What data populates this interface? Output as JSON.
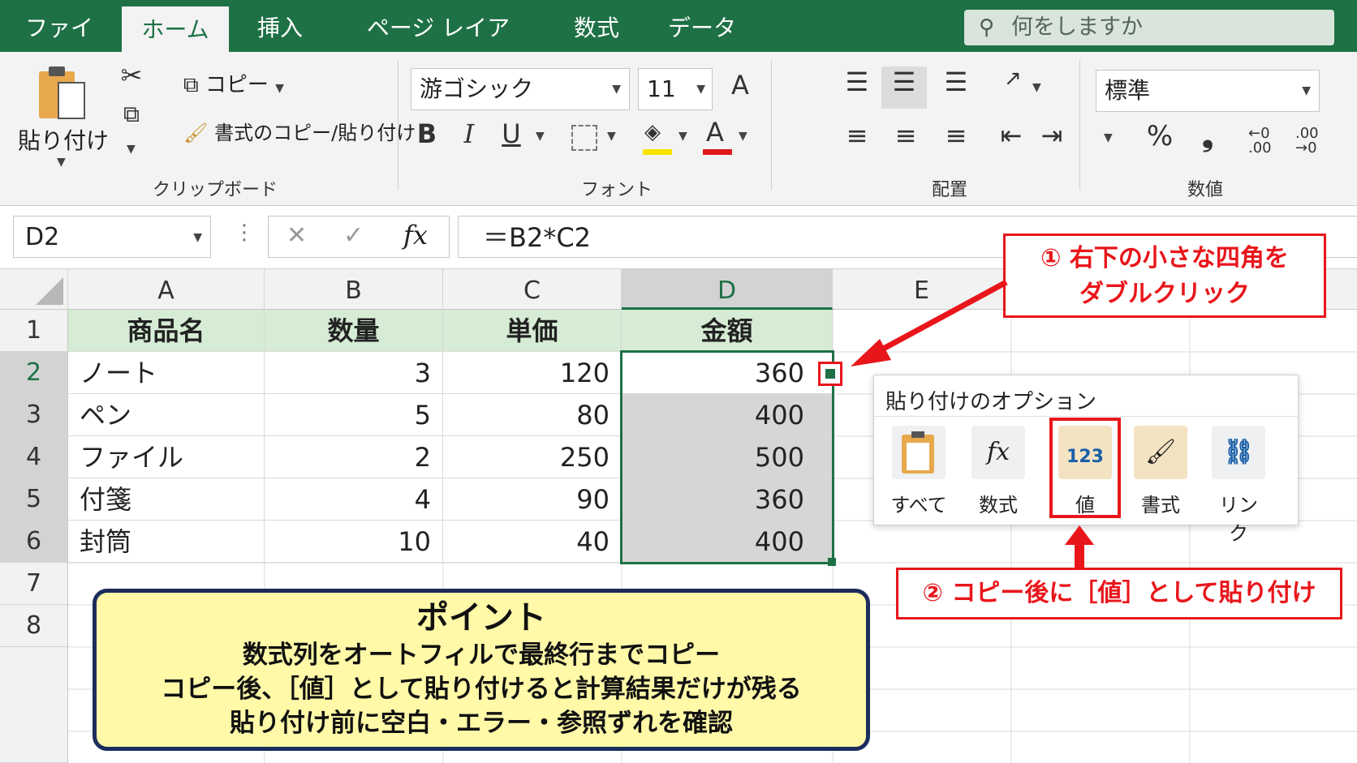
{
  "tabs": [
    "ファイル",
    "ホーム",
    "挿入",
    "ページ レイアウト",
    "数式",
    "データ"
  ],
  "search": {
    "placeholder": "何をしますか"
  },
  "ribbon": {
    "clipboard": {
      "paste_label": "貼り付け",
      "copy_label": "コピー",
      "format_painter_label": "書式のコピー/貼り付け",
      "group_label": "クリップボード"
    },
    "font": {
      "name": "游ゴシック",
      "size": "11",
      "group_label": "フォント",
      "bold": "B",
      "italic": "I",
      "underline": "U",
      "font_color_glyph": "A",
      "grow_glyph": "A"
    },
    "alignment": {
      "group_label": "配置"
    },
    "number": {
      "format": "標準",
      "group_label": "数値",
      "percent": "%",
      "comma": "❟",
      "inc_decimal": ".00",
      "dec_decimal": ".00"
    }
  },
  "formula_bar": {
    "name_box": "D2",
    "formula": "＝B2*C2",
    "fx": "fx"
  },
  "columns": [
    "A",
    "B",
    "C",
    "D",
    "E"
  ],
  "rows": [
    "1",
    "2",
    "3",
    "4",
    "5",
    "6",
    "7",
    "8"
  ],
  "table": {
    "headers": [
      "商品名",
      "数量",
      "単価",
      "金額"
    ],
    "data": [
      [
        "ノート",
        "3",
        "120",
        "360"
      ],
      [
        "ペン",
        "5",
        "80",
        "400"
      ],
      [
        "ファイル",
        "2",
        "250",
        "500"
      ],
      [
        "付箋",
        "4",
        "90",
        "360"
      ],
      [
        "封筒",
        "10",
        "40",
        "400"
      ]
    ]
  },
  "callout1": {
    "line1": "① 右下の小さな四角を",
    "line2": "ダブルクリック"
  },
  "callout2": {
    "text": "② コピー後に［値］として貼り付け"
  },
  "paste_options": {
    "title": "貼り付けのオプション",
    "items": [
      {
        "label": "すべて",
        "icon": "paste-all-icon"
      },
      {
        "label": "数式",
        "icon": "formula-fx-icon"
      },
      {
        "label": "値",
        "icon": "paste-values-123-icon",
        "icon_text": "123"
      },
      {
        "label": "書式",
        "icon": "paste-format-brush-icon"
      },
      {
        "label": "リンク",
        "icon": "paste-link-icon"
      }
    ]
  },
  "point": {
    "title": "ポイント",
    "lines": [
      "数式列をオートフィルで最終行までコピー",
      "コピー後、［値］として貼り付けると計算結果だけが残る",
      "貼り付け前に空白・エラー・参照ずれを確認"
    ]
  },
  "colors": {
    "excel_green": "#1e7145",
    "header_fill": "#d6ecd4",
    "callout_red": "#e8161b",
    "note_yellow": "#fff9a8",
    "note_border": "#1c2d5c"
  }
}
